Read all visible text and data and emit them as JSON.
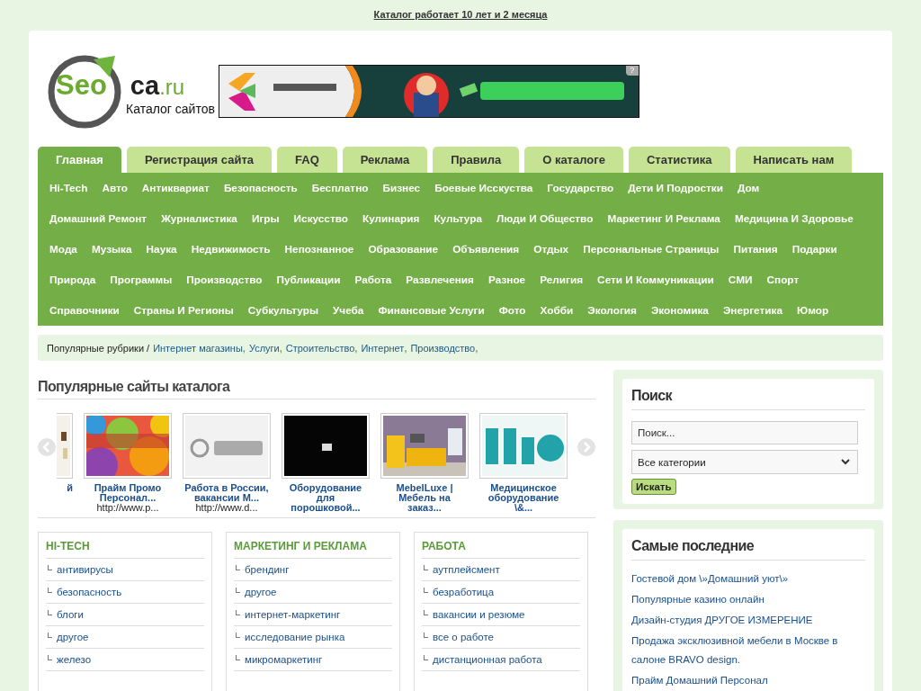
{
  "top_notice": "Каталог работает 10 лет и 2 месяца",
  "logo": {
    "part_1": "Seo",
    "part_2": "ca",
    "part_3": ".ru",
    "tagline": "Каталог сайтов"
  },
  "banner": {
    "kind": "picture",
    "help": "?"
  },
  "tabs": [
    {
      "label": "Главная",
      "selected": true
    },
    {
      "label": "Регистрация сайта",
      "selected": false
    },
    {
      "label": "FAQ",
      "selected": false
    },
    {
      "label": "Реклама",
      "selected": false
    },
    {
      "label": "Правила",
      "selected": false
    },
    {
      "label": "О каталоге",
      "selected": false
    },
    {
      "label": "Статистика",
      "selected": false
    },
    {
      "label": "Написать нам",
      "selected": false
    }
  ],
  "category_rows": [
    [
      "Hi-Tech",
      "Авто",
      "Антиквариат",
      "Безопасность",
      "Бесплатно",
      "Бизнес",
      "Боевые Исскуства",
      "Государство",
      "Дети И Подростки",
      "Дом"
    ],
    [
      "Домашний Ремонт",
      "Журналистика",
      "Игры",
      "Искусство",
      "Кулинария",
      "Культура",
      "Люди И Общество",
      "Маркетинг И Реклама",
      "Медицина И Здоровье"
    ],
    [
      "Мода",
      "Музыка",
      "Наука",
      "Недвижимость",
      "Непознанное",
      "Образование",
      "Объявления",
      "Отдых",
      "Персональные Страницы",
      "Питания",
      "Подарки"
    ],
    [
      "Природа",
      "Программы",
      "Производство",
      "Публикации",
      "Работа",
      "Развлечения",
      "Разное",
      "Религия",
      "Сети И Коммуникации",
      "СМИ",
      "Спорт"
    ],
    [
      "Справочники",
      "Страны И Регионы",
      "Субкультуры",
      "Учеба",
      "Финансовые Услуги",
      "Фото",
      "Хобби",
      "Экология",
      "Экономика",
      "Энергетика",
      "Юмор"
    ]
  ],
  "popular_rubrics": {
    "label": "Популярные рубрики /",
    "links": [
      "Интернет магазины",
      "Услуги",
      "Строительство",
      "Интернет",
      "Производство"
    ],
    "separator": ","
  },
  "popular_sites": {
    "title": "Популярные сайты каталога",
    "items": [
      {
        "kind": "partial",
        "title": "й"
      },
      {
        "kind": "full",
        "title": "Прайм Промо Персонал...",
        "url": "http://www.p..."
      },
      {
        "kind": "full",
        "title": "Работа в России, вакансии М...",
        "url": "http://www.d..."
      },
      {
        "kind": "full",
        "title": "Оборудование для порошковой..."
      },
      {
        "kind": "full",
        "title": "MebelLuxe | Мебель на заказ..."
      },
      {
        "kind": "full",
        "title": "Медицинское оборудование \\&..."
      }
    ]
  },
  "category_boxes": [
    {
      "title": "HI-TECH",
      "items": [
        "антивирусы",
        "безопасность",
        "блоги",
        "другое",
        "железо"
      ]
    },
    {
      "title": "МАРКЕТИНГ И РЕКЛАМА",
      "items": [
        "брендинг",
        "другое",
        "интернет-маркетинг",
        "исследование рынка",
        "микромаркетинг"
      ]
    },
    {
      "title": "РАБОТА",
      "items": [
        "аутплейсмент",
        "безработица",
        "вакансии и резюме",
        "все о работе",
        "дистанционная работа"
      ]
    }
  ],
  "search": {
    "title": "Поиск",
    "placeholder": "Поиск...",
    "category": "Все категории",
    "button": "Искать"
  },
  "latest": {
    "title": "Самые последние",
    "items": [
      "Гостевой дом \\»Домашний уют\\»",
      "Популярные казино онлайн",
      "Дизайн-студия ДРУГОЕ ИЗМЕРЕНИЕ",
      "Продажа эксклюзивной мебели в Москве в салоне BRAVO design.",
      "Прайм Домашний Персонал"
    ]
  }
}
